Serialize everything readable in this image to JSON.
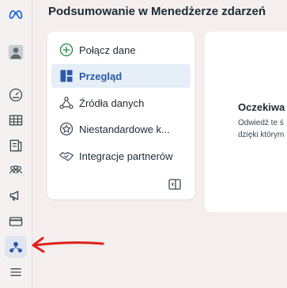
{
  "header": {
    "title": "Podsumowanie w Menedżerze zdarzeń"
  },
  "nav_rail": {
    "items": [
      {
        "name": "meta-logo-icon"
      },
      {
        "name": "avatar"
      },
      {
        "name": "dashboard-gauge-icon"
      },
      {
        "name": "table-icon"
      },
      {
        "name": "catalog-icon"
      },
      {
        "name": "audiences-icon"
      },
      {
        "name": "megaphone-icon"
      },
      {
        "name": "billing-card-icon"
      },
      {
        "name": "events-manager-icon",
        "active": true
      },
      {
        "name": "menu-icon"
      }
    ]
  },
  "side_menu": {
    "items": [
      {
        "label": "Połącz dane",
        "icon": "plus-circle-icon",
        "selected": false
      },
      {
        "label": "Przegląd",
        "icon": "overview-icon",
        "selected": true
      },
      {
        "label": "Źródła danych",
        "icon": "data-sources-icon",
        "selected": false
      },
      {
        "label": "Niestandardowe k...",
        "icon": "custom-conversions-icon",
        "selected": false
      },
      {
        "label": "Integracje partnerów",
        "icon": "handshake-icon",
        "selected": false
      }
    ],
    "collapse_icon": "panel-collapse-icon"
  },
  "main": {
    "heading": "Oczekiwa",
    "text_line1": "Odwiedź te ś",
    "text_line2": "dzięki którym"
  },
  "annotation": {
    "arrow_color": "#e0201b"
  },
  "colors": {
    "accent": "#2b5aa6",
    "active_bg": "#dfe6f2",
    "text": "#1c2b33"
  }
}
